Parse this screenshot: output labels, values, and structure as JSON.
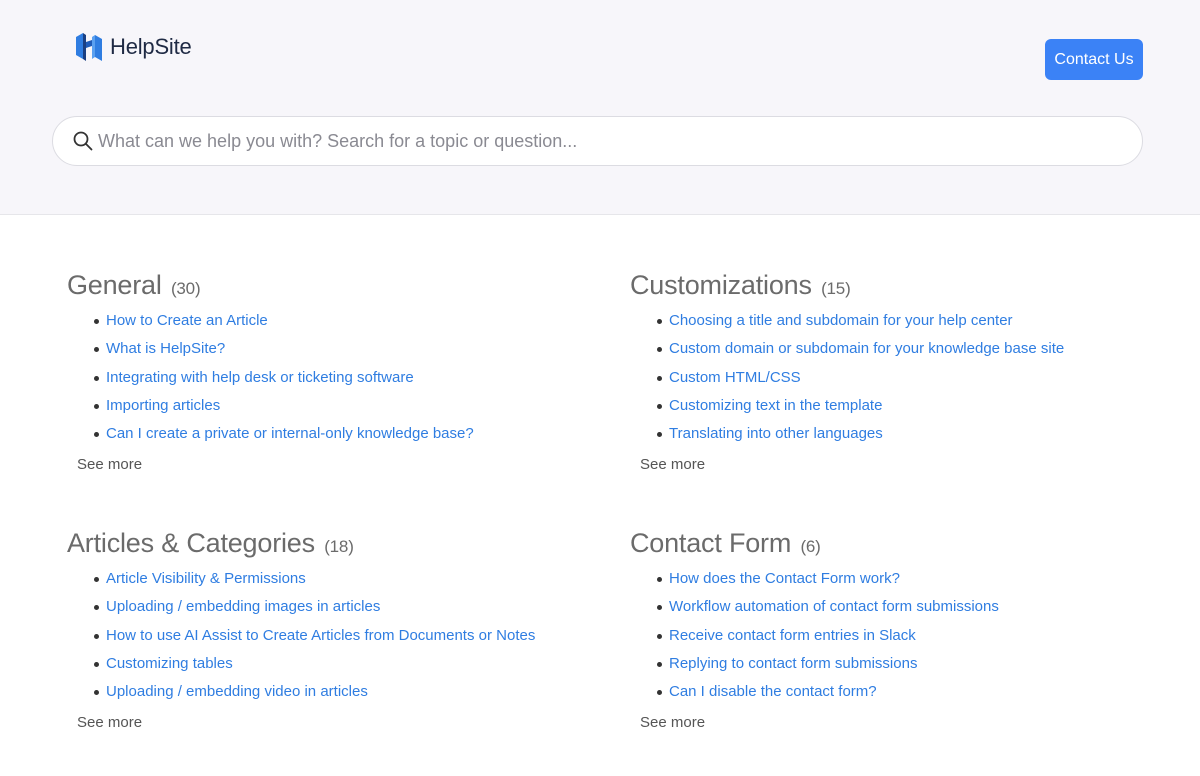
{
  "header": {
    "logo_text": "HelpSite",
    "contact_label": "Contact Us",
    "search_placeholder": "What can we help you with? Search for a topic or question..."
  },
  "colors": {
    "accent": "#3b82f6",
    "link": "#2f7de1",
    "background": "#f7f6fa"
  },
  "sections": [
    {
      "title": "General",
      "count": "(30)",
      "articles": [
        "How to Create an Article",
        "What is HelpSite?",
        "Integrating with help desk or ticketing software",
        "Importing articles",
        "Can I create a private or internal-only knowledge base?"
      ],
      "see_more": "See more"
    },
    {
      "title": "Customizations",
      "count": "(15)",
      "articles": [
        "Choosing a title and subdomain for your help center",
        "Custom domain or subdomain for your knowledge base site",
        "Custom HTML/CSS",
        "Customizing text in the template",
        "Translating into other languages"
      ],
      "see_more": "See more"
    },
    {
      "title": "Articles & Categories",
      "count": "(18)",
      "articles": [
        "Article Visibility & Permissions",
        "Uploading / embedding images in articles",
        "How to use AI Assist to Create Articles from Documents or Notes",
        "Customizing tables",
        "Uploading / embedding video in articles"
      ],
      "see_more": "See more"
    },
    {
      "title": "Contact Form",
      "count": "(6)",
      "articles": [
        "How does the Contact Form work?",
        "Workflow automation of contact form submissions",
        "Receive contact form entries in Slack",
        "Replying to contact form submissions",
        "Can I disable the contact form?"
      ],
      "see_more": "See more"
    }
  ]
}
